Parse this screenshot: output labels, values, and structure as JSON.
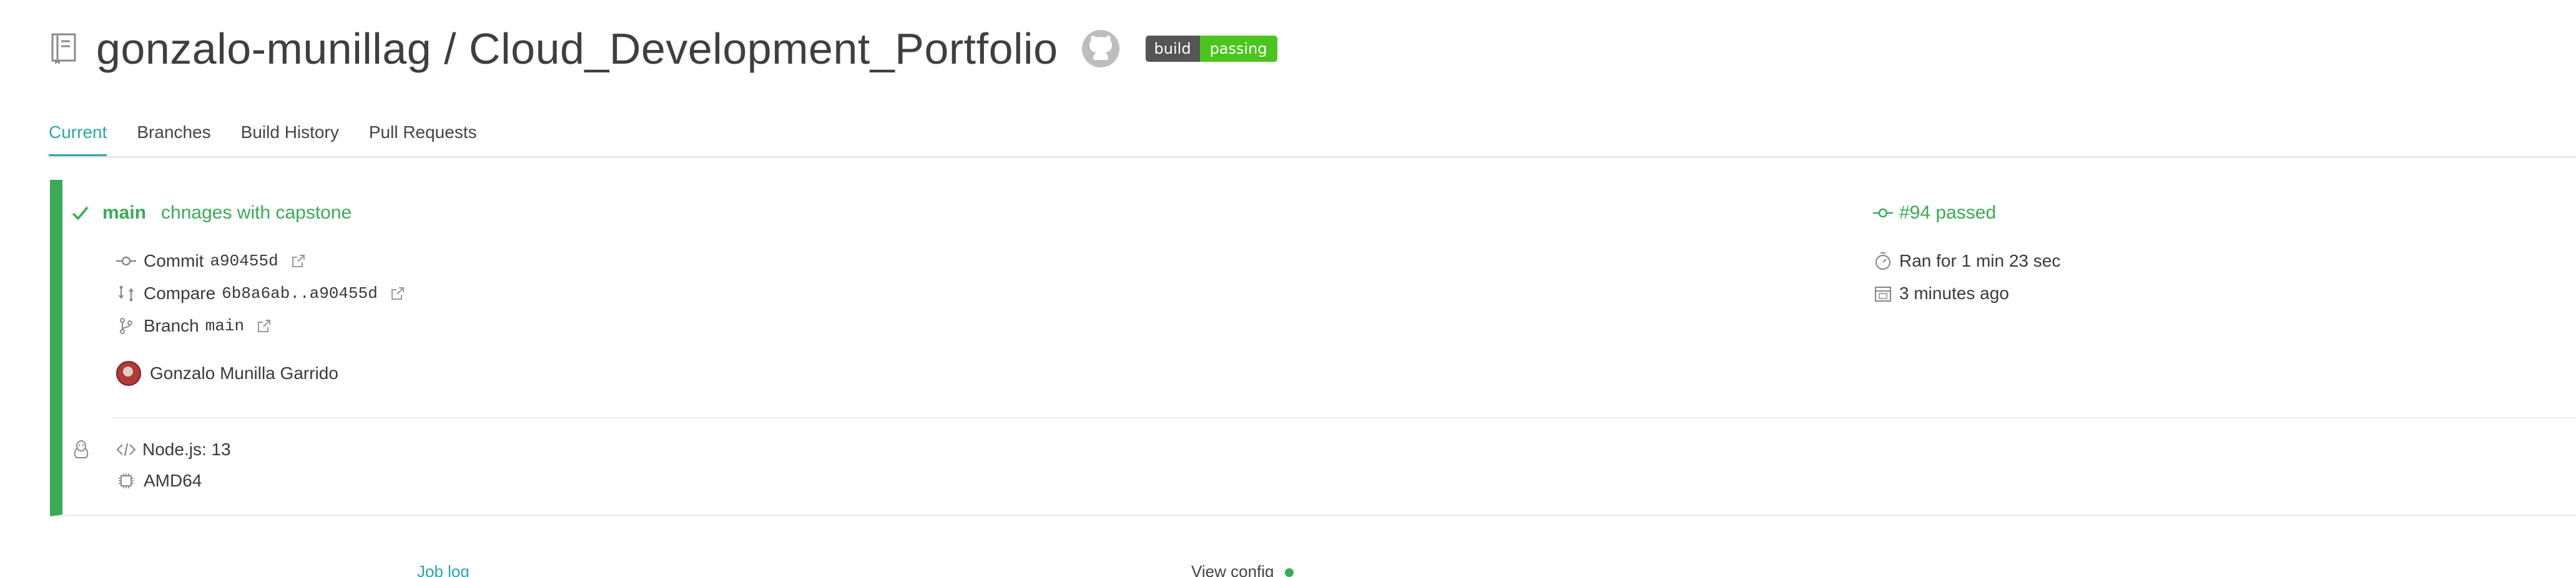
{
  "header": {
    "repo_title": "gonzalo-munillag / Cloud_Development_Portfolio",
    "badge_left": "build",
    "badge_right": "passing",
    "icons": [
      "repo-icon",
      "github-icon"
    ]
  },
  "tabs": [
    {
      "label": "Current",
      "active": true
    },
    {
      "label": "Branches",
      "active": false
    },
    {
      "label": "Build History",
      "active": false
    },
    {
      "label": "Pull Requests",
      "active": false
    }
  ],
  "build": {
    "status_color": "#39aa56",
    "branch": "main",
    "message": "chnages with capstone",
    "number_status": "#94 passed",
    "commit_label": "Commit",
    "commit_hash": "a90455d",
    "compare_label": "Compare",
    "compare_range": "6b8a6ab..a90455d",
    "branch_label": "Branch",
    "branch_value": "main",
    "author": "Gonzalo Munilla Garrido",
    "duration": "Ran for 1 min 23 sec",
    "finished": "3 minutes ago",
    "language": "Node.js: 13",
    "arch": "AMD64"
  },
  "bottom": {
    "job_log": "Job log",
    "view_config": "View config"
  },
  "colors": {
    "accent": "#2aa7a9",
    "passed": "#39aa56",
    "badge_green": "#4bc51d"
  }
}
